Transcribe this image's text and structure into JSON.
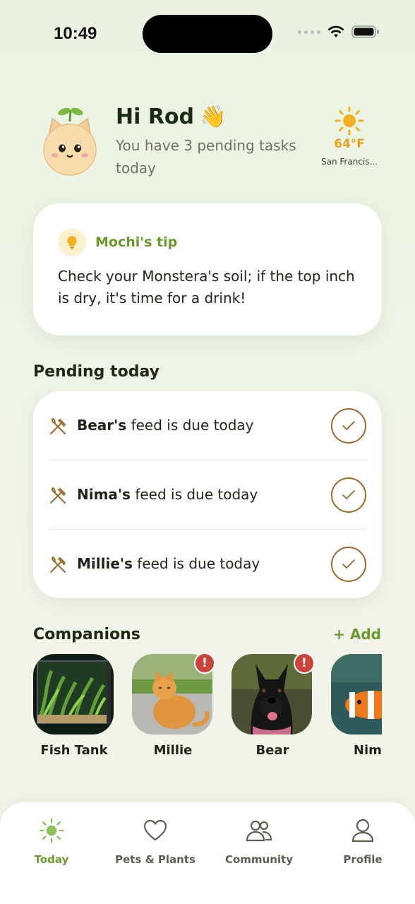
{
  "status_bar": {
    "time": "10:49"
  },
  "header": {
    "greeting": "Hi Rod",
    "wave_emoji": "👋",
    "subtext": "You have 3 pending tasks today",
    "weather": {
      "icon": "sun-icon",
      "temp": "64°F",
      "city": "San Francis..."
    }
  },
  "tip": {
    "title": "Mochi's tip",
    "text": "Check your Monstera's soil; if the top inch is dry, it's time for a drink!",
    "icon": "lightbulb-icon"
  },
  "pending": {
    "title": "Pending today",
    "tasks": [
      {
        "name": "Bear's",
        "text": "feed is due today",
        "icon": "fork-knife-icon"
      },
      {
        "name": "Nima's",
        "text": "feed is due today",
        "icon": "fork-knife-icon"
      },
      {
        "name": "Millie's",
        "text": "feed is due today",
        "icon": "fork-knife-icon"
      }
    ]
  },
  "companions": {
    "title": "Companions",
    "add_label": "+ Add",
    "items": [
      {
        "name": "Fish Tank",
        "alert": false
      },
      {
        "name": "Millie",
        "alert": true,
        "badge": "!"
      },
      {
        "name": "Bear",
        "alert": true,
        "badge": "!"
      },
      {
        "name": "Nima",
        "alert": false
      }
    ]
  },
  "nav": {
    "items": [
      {
        "label": "Today",
        "icon": "sun-icon",
        "active": true
      },
      {
        "label": "Pets & Plants",
        "icon": "heart-icon",
        "active": false
      },
      {
        "label": "Community",
        "icon": "people-icon",
        "active": false
      },
      {
        "label": "Profile",
        "icon": "person-icon",
        "active": false
      }
    ]
  },
  "colors": {
    "accent_green": "#6a9a2e",
    "check_brown": "#9a6a2a",
    "alert_red": "#c9443b",
    "sun_yellow": "#f2b01e"
  }
}
